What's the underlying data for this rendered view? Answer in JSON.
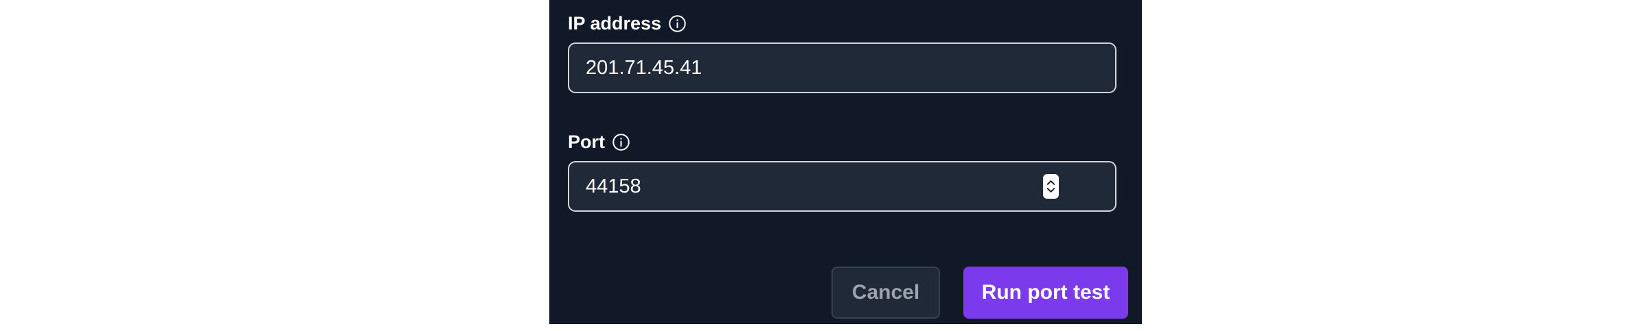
{
  "form": {
    "ip_label": "IP address",
    "ip_value": "201.71.45.41",
    "port_label": "Port",
    "port_value": "44158"
  },
  "actions": {
    "cancel_label": "Cancel",
    "run_label": "Run port test"
  },
  "icons": {
    "label_info": "info-circle-icon",
    "stepper_up": "chevron-up-icon",
    "stepper_down": "chevron-down-icon"
  },
  "colors": {
    "panel_bg": "#111827",
    "input_bg": "#1f2937",
    "primary": "#7c3aed"
  }
}
